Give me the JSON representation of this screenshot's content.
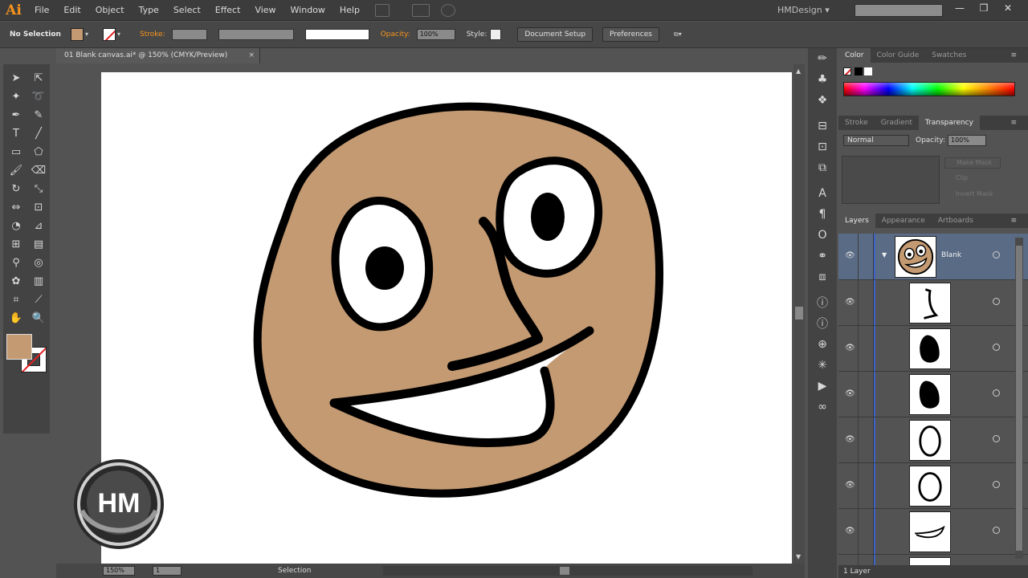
{
  "app": {
    "logo": "Ai",
    "workspace": "HMDesign",
    "workspace_caret": "▾"
  },
  "menu": [
    "File",
    "Edit",
    "Object",
    "Type",
    "Select",
    "Effect",
    "View",
    "Window",
    "Help"
  ],
  "window_controls": {
    "minimize": "—",
    "restore": "❐",
    "close": "✕"
  },
  "controlbar": {
    "selection": "No Selection",
    "stroke_label": "Stroke:",
    "opacity_label": "Opacity:",
    "opacity_value": "100%",
    "style_label": "Style:",
    "document_setup": "Document Setup",
    "preferences": "Preferences"
  },
  "document": {
    "tab_title": "01 Blank canvas.ai* @ 150% (CMYK/Preview)",
    "close": "×"
  },
  "statusbar": {
    "zoom": "150%",
    "artboard": "1",
    "status": "Selection"
  },
  "panels": {
    "color_tabs": [
      "Color",
      "Color Guide",
      "Swatches"
    ],
    "transparency_tabs": [
      "Stroke",
      "Gradient",
      "Transparency"
    ],
    "blend_mode": "Normal",
    "opacity_label": "Opacity:",
    "opacity_value": "100%",
    "mask_buttons": [
      "Make Mask",
      "Clip",
      "Invert Mask"
    ],
    "layers_tabs": [
      "Layers",
      "Appearance",
      "Artboards"
    ],
    "top_layer_name": "Blank",
    "layers_footer": "1 Layer"
  },
  "logo_text": "HM",
  "colors": {
    "skin": "#c49a72",
    "outline": "#000000",
    "accent": "#f7941d",
    "selection_row": "#5a6b86",
    "layer_line": "#3d63c7"
  },
  "tools": [
    "selection-icon",
    "direct-selection-icon",
    "magic-wand-icon",
    "lasso-icon",
    "pen-icon",
    "curvature-icon",
    "type-icon",
    "line-icon",
    "rectangle-icon",
    "shaper-icon",
    "paintbrush-icon",
    "eraser-icon",
    "rotate-icon",
    "scale-icon",
    "width-icon",
    "free-transform-icon",
    "shape-builder-icon",
    "perspective-icon",
    "mesh-icon",
    "gradient-icon",
    "eyedropper-icon",
    "blend-icon",
    "symbol-sprayer-icon",
    "graph-icon",
    "artboard-icon",
    "slice-icon",
    "hand-icon",
    "zoom-icon"
  ],
  "dock_icons": [
    "brushes-icon",
    "symbols-icon",
    "graphic-styles-icon",
    "align-icon",
    "transform-icon",
    "pathfinder-icon",
    "character-icon",
    "paragraph-icon",
    "opentype-icon",
    "links-icon",
    "image-trace-icon",
    "info-icon",
    "document-info-icon",
    "navigator-icon",
    "attributes-icon",
    "actions-icon",
    "links-chain-icon"
  ]
}
